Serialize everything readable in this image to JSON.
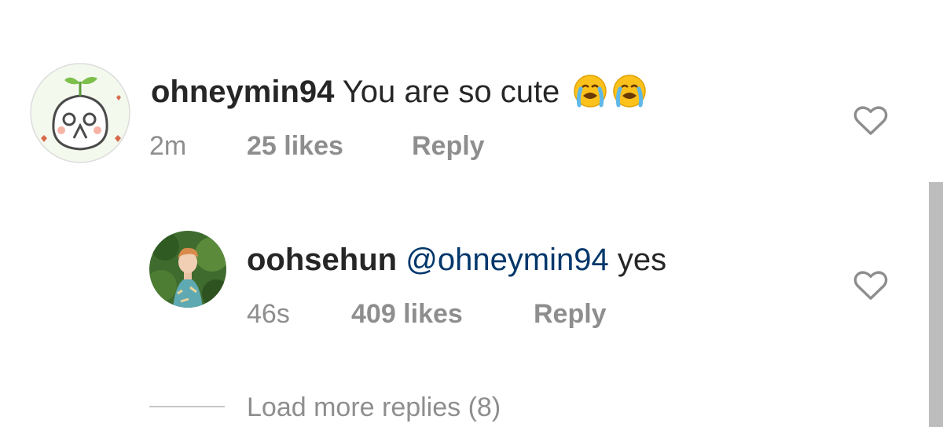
{
  "comments": [
    {
      "username": "ohneymin94",
      "text": "You are so cute",
      "emoji": [
        "loudly-crying-face-emoji",
        "loudly-crying-face-emoji"
      ],
      "time": "2m",
      "likes": "25 likes",
      "reply_label": "Reply",
      "avatar_icon": "cartoon-sprout-character-avatar"
    },
    {
      "username": "oohsehun",
      "mention": "@ohneymin94",
      "text": "yes",
      "time": "46s",
      "likes": "409 likes",
      "reply_label": "Reply",
      "avatar_icon": "profile-photo-avatar"
    }
  ],
  "load_more": {
    "label": "Load more replies (8)"
  },
  "icons": {
    "like": "heart-outline-icon"
  },
  "colors": {
    "text": "#262626",
    "secondary": "#8e8e8e",
    "mention": "#00376b",
    "background": "#ffffff"
  }
}
